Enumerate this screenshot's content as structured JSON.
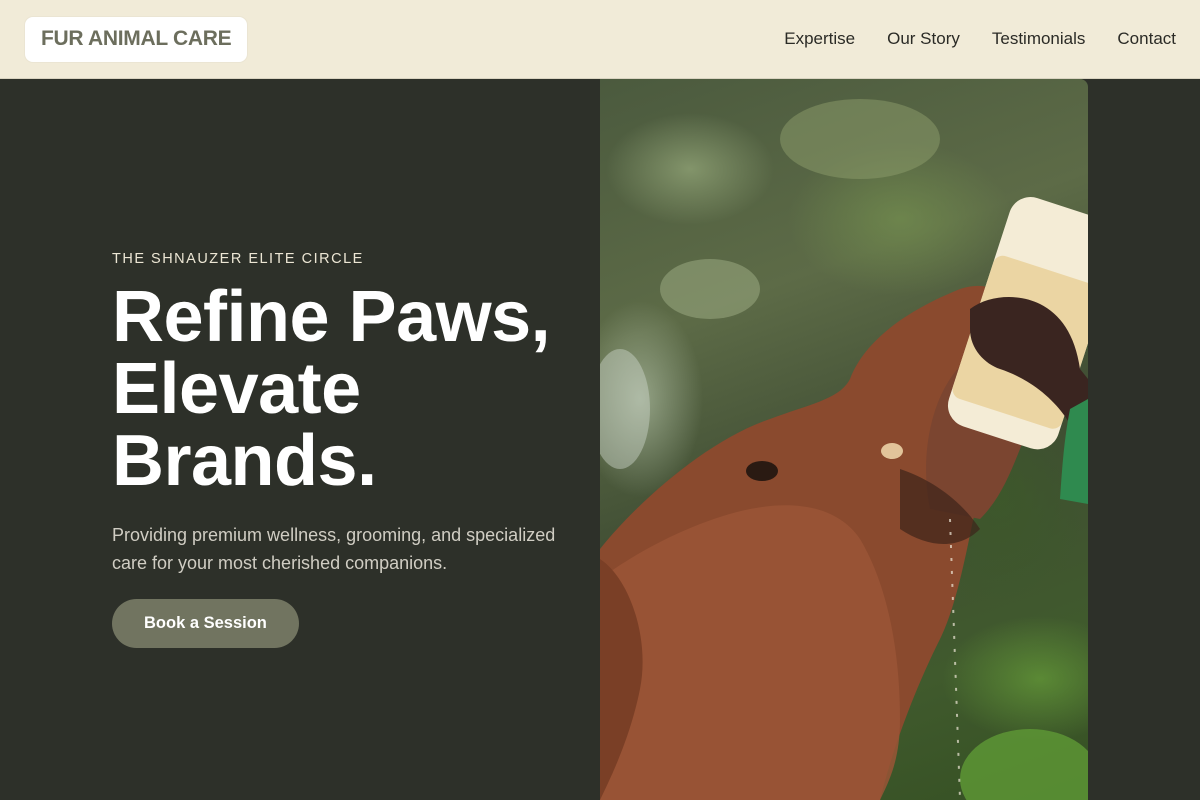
{
  "header": {
    "logo": "FUR ANIMAL CARE",
    "nav": [
      {
        "label": "Expertise"
      },
      {
        "label": "Our Story"
      },
      {
        "label": "Testimonials"
      },
      {
        "label": "Contact"
      }
    ]
  },
  "hero": {
    "eyebrow": "THE SHNAUZER ELITE CIRCLE",
    "headline_lines": [
      "Refine Paws,",
      "Elevate",
      "Brands."
    ],
    "subtext": "Providing premium wellness, grooming, and specialized care for your most cherished companions.",
    "cta_label": "Book a Session"
  },
  "colors": {
    "header_bg": "#f1ebd8",
    "hero_bg": "#2d3029",
    "accent": "#717460",
    "logo_text": "#6c6e5d"
  },
  "icons": {
    "photo": "baby-elephant-bottle-feeding-image"
  }
}
